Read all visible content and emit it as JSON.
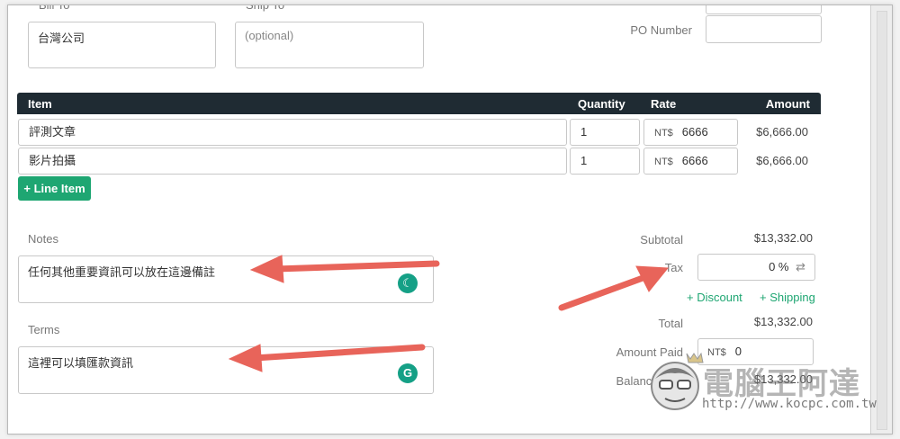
{
  "bill_to": {
    "label": "Bill To",
    "value": "台灣公司"
  },
  "ship_to": {
    "label": "Ship To",
    "placeholder": "(optional)"
  },
  "po_number": {
    "label": "PO Number",
    "value": ""
  },
  "table": {
    "headers": {
      "item": "Item",
      "quantity": "Quantity",
      "rate": "Rate",
      "amount": "Amount"
    },
    "rows": [
      {
        "item": "評測文章",
        "quantity": "1",
        "currency": "NT$",
        "rate": "6666",
        "amount": "$6,666.00"
      },
      {
        "item": "影片拍攝",
        "quantity": "1",
        "currency": "NT$",
        "rate": "6666",
        "amount": "$6,666.00"
      }
    ],
    "add_label": "+ Line Item"
  },
  "notes": {
    "label": "Notes",
    "value": "任何其他重要資訊可以放在這邊備註"
  },
  "terms": {
    "label": "Terms",
    "value": "這裡可以填匯款資訊"
  },
  "totals": {
    "subtotal_label": "Subtotal",
    "subtotal_value": "$13,332.00",
    "tax_label": "Tax",
    "tax_value": "0 %",
    "discount_label": "+ Discount",
    "shipping_label": "+ Shipping",
    "total_label": "Total",
    "total_value": "$13,332.00",
    "amount_paid_label": "Amount Paid",
    "amount_paid_currency": "NT$",
    "amount_paid_value": "0",
    "balance_due_label": "Balance Due",
    "balance_due_value": "$13,332.00"
  },
  "watermark": {
    "name": "電腦王阿達",
    "url": "http://www.kocpc.com.tw"
  },
  "colors": {
    "header_bg": "#1f2b33",
    "accent": "#1ea672",
    "arrow": "#e8645a",
    "badge": "#15a086"
  }
}
